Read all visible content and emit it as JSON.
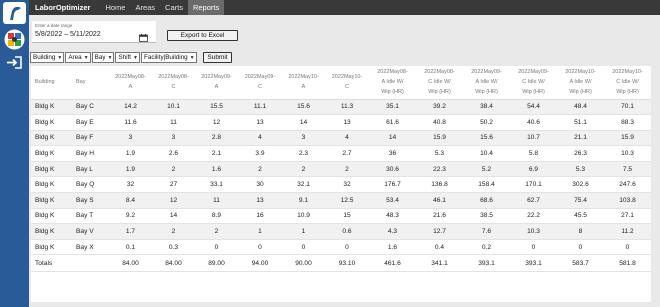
{
  "app": {
    "name": "LaborOptimizer"
  },
  "nav": [
    {
      "label": "Home",
      "active": false
    },
    {
      "label": "Areas",
      "active": false
    },
    {
      "label": "Carts",
      "active": false
    },
    {
      "label": "Reports",
      "active": true
    }
  ],
  "date_range": {
    "label": "Enter a date range",
    "value": "5/8/2022 – 5/11/2022"
  },
  "export_label": "Export to Excel",
  "filters": [
    "Building",
    "Area",
    "Bay",
    "Shift",
    "Facility|Building"
  ],
  "submit_label": "Submit",
  "table": {
    "headers": [
      [
        "Building"
      ],
      [
        "Bay"
      ],
      [
        "2022May08-",
        "A"
      ],
      [
        "2022May08-",
        "C"
      ],
      [
        "2022May09-",
        "A"
      ],
      [
        "2022May09-",
        "C"
      ],
      [
        "2022May10-",
        "A"
      ],
      [
        "2022May10-",
        "C"
      ],
      [
        "2022May08-",
        "A Idle W/",
        "Wip (HR)"
      ],
      [
        "2022May08-",
        "C Idle W/",
        "Wip (HR)"
      ],
      [
        "2022May09-",
        "A Idle W/",
        "Wip (HR)"
      ],
      [
        "2022May09-",
        "C Idle W/",
        "Wip (HR)"
      ],
      [
        "2022May10-",
        "A Idle W/",
        "Wip (HR)"
      ],
      [
        "2022May10-",
        "C Idle W/",
        "Wip (HR)"
      ]
    ],
    "rows": [
      [
        "Bldg K",
        "Bay C",
        "14.2",
        "10.1",
        "15.5",
        "11.1",
        "15.6",
        "11.3",
        "35.1",
        "39.2",
        "38.4",
        "54.4",
        "48.4",
        "70.1"
      ],
      [
        "Bldg K",
        "Bay E",
        "11.6",
        "11",
        "12",
        "13",
        "14",
        "13",
        "61.6",
        "40.8",
        "50.2",
        "40.6",
        "51.1",
        "88.3"
      ],
      [
        "Bldg K",
        "Bay F",
        "3",
        "3",
        "2.8",
        "4",
        "3",
        "4",
        "14",
        "15.9",
        "15.6",
        "10.7",
        "21.1",
        "15.9"
      ],
      [
        "Bldg K",
        "Bay H",
        "1.9",
        "2.6",
        "2.1",
        "3.9",
        "2.3",
        "2.7",
        "36",
        "5.3",
        "10.4",
        "5.8",
        "26.3",
        "10.3"
      ],
      [
        "Bldg K",
        "Bay L",
        "1.9",
        "2",
        "1.6",
        "2",
        "2",
        "2",
        "30.6",
        "22.3",
        "5.2",
        "6.9",
        "5.3",
        "7.5"
      ],
      [
        "Bldg K",
        "Bay Q",
        "32",
        "27",
        "33.1",
        "30",
        "32.1",
        "32",
        "176.7",
        "136.8",
        "158.4",
        "170.1",
        "302.6",
        "247.6"
      ],
      [
        "Bldg K",
        "Bay S",
        "8.4",
        "12",
        "11",
        "13",
        "9.1",
        "12.5",
        "53.4",
        "46.1",
        "68.6",
        "62.7",
        "75.4",
        "103.8"
      ],
      [
        "Bldg K",
        "Bay T",
        "9.2",
        "14",
        "8.9",
        "16",
        "10.9",
        "15",
        "48.3",
        "21.6",
        "38.5",
        "22.2",
        "45.5",
        "27.1"
      ],
      [
        "Bldg K",
        "Bay V",
        "1.7",
        "2",
        "2",
        "1",
        "1",
        "0.6",
        "4.3",
        "12.7",
        "7.6",
        "10.3",
        "8",
        "11.2"
      ],
      [
        "Bldg K",
        "Bay X",
        "0.1",
        "0.3",
        "0",
        "0",
        "0",
        "0",
        "1.6",
        "0.4",
        "0.2",
        "0",
        "0",
        "0"
      ]
    ],
    "totals": [
      "Totals",
      "",
      "84.00",
      "84.00",
      "89.00",
      "94.00",
      "90.00",
      "93.10",
      "461.6",
      "341.1",
      "393.1",
      "393.1",
      "583.7",
      "581.8"
    ]
  }
}
